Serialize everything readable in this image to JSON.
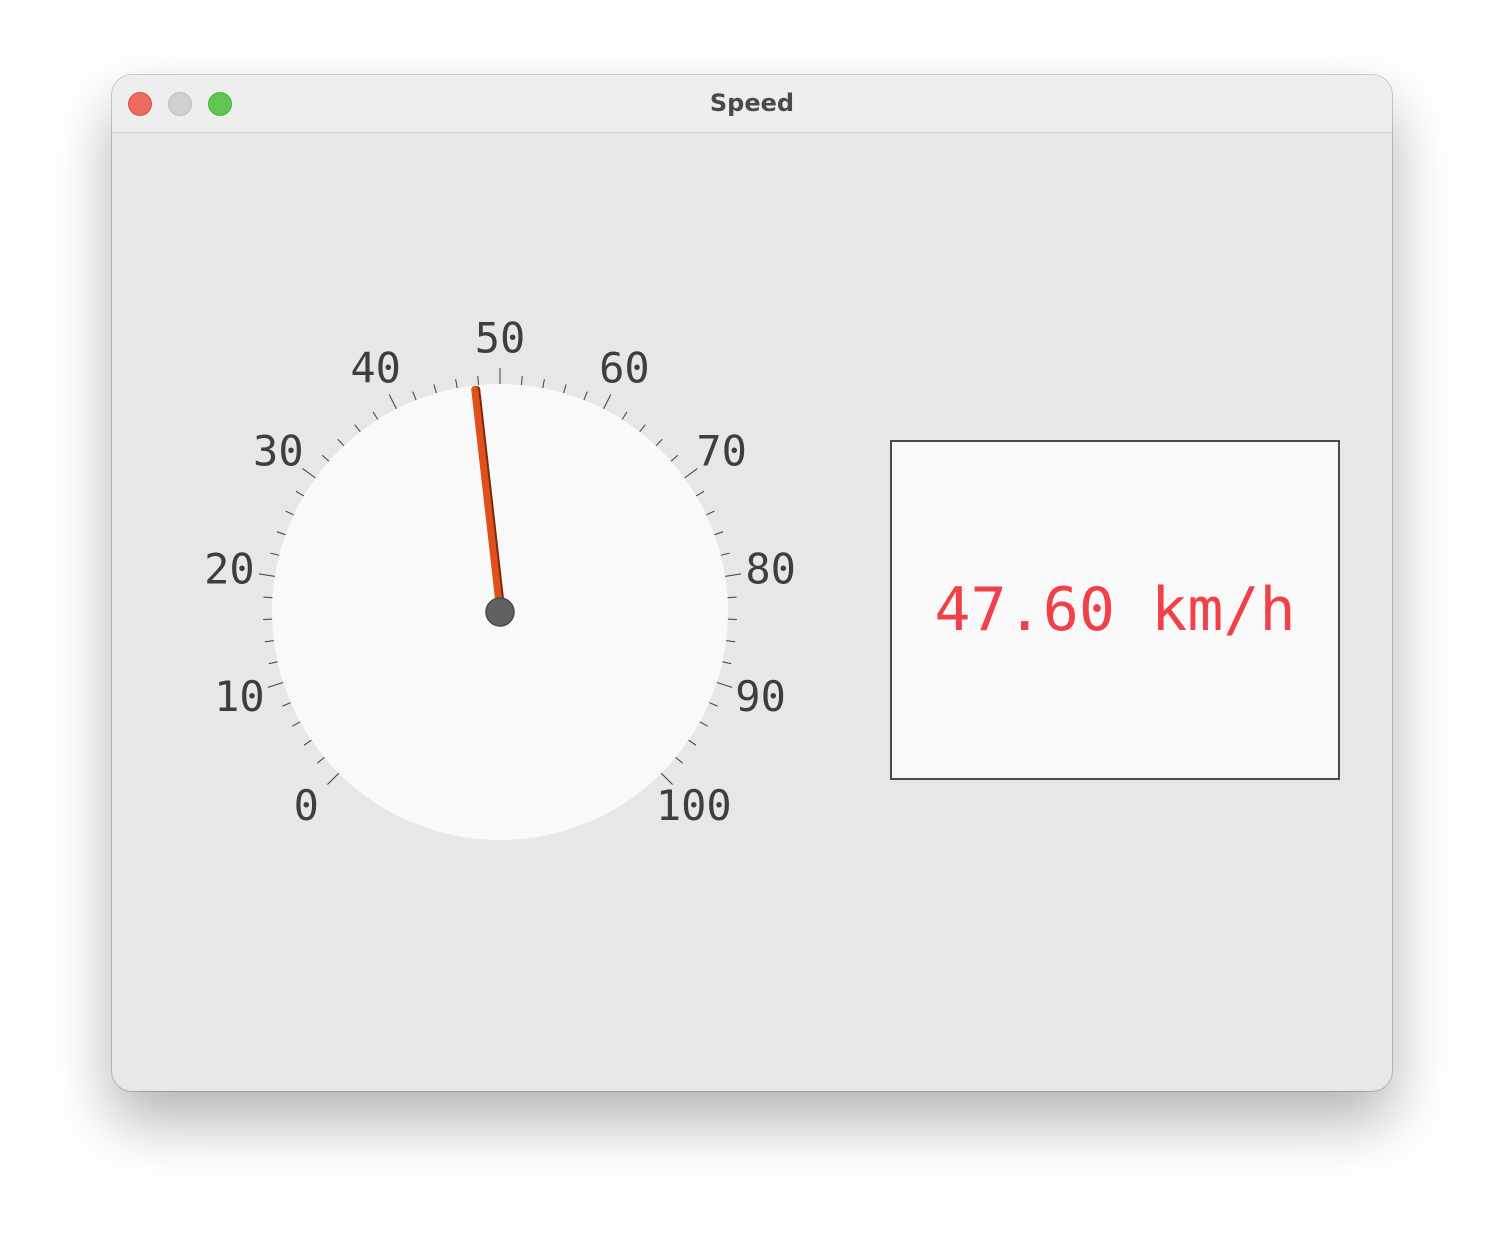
{
  "window": {
    "title": "Speed"
  },
  "gauge": {
    "min": 0,
    "max": 100,
    "value": 47.6,
    "major_step": 10,
    "minor_per_major": 5,
    "start_angle_deg": -135,
    "end_angle_deg": 135,
    "tick_labels": [
      "0",
      "10",
      "20",
      "30",
      "40",
      "50",
      "60",
      "70",
      "80",
      "90",
      "100"
    ],
    "needle_color": "#e0501c",
    "dial_color": "#f9f9f9",
    "hub_color": "#616161"
  },
  "readout": {
    "value_text": "47.60 km/h",
    "color": "#f04149"
  }
}
